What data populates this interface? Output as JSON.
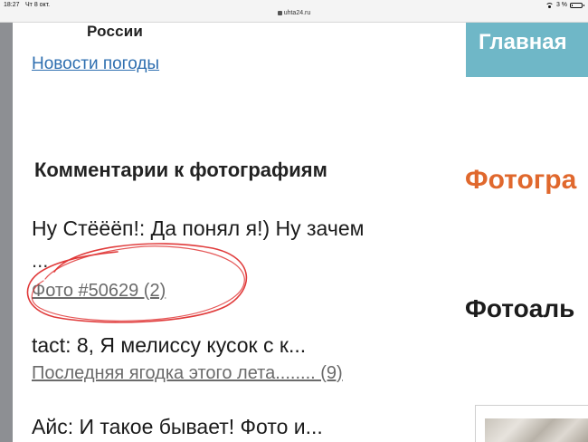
{
  "status_bar": {
    "time": "18:27",
    "date": "Чт 8 окт.",
    "url": "uhta24.ru",
    "battery": "3 %",
    "battery_level": 0.03
  },
  "left": {
    "logo_caption": "России",
    "weather_link": "Новости погоды",
    "section_title": "Комментарии к фотографиям",
    "comments": [
      {
        "text": "Ну Стёёёп!: Да понял я!) Ну зачем",
        "text_cont": "...",
        "link": "Фото #50629 (2)"
      },
      {
        "text": "tact: 8, Я мелиссу кусок с к...",
        "link": "Последняя ягодка этого лета........ (9)"
      },
      {
        "text": "Айс: И такое бывает! Фото и..."
      }
    ]
  },
  "right": {
    "menu_label": "Главная",
    "orange_title": "Фотогра",
    "dark_title": "Фотоаль"
  },
  "colors": {
    "link": "#2f6fb0",
    "menu_bg": "#6fb7c7",
    "orange": "#e0682d",
    "annotation": "#e03a3a"
  }
}
